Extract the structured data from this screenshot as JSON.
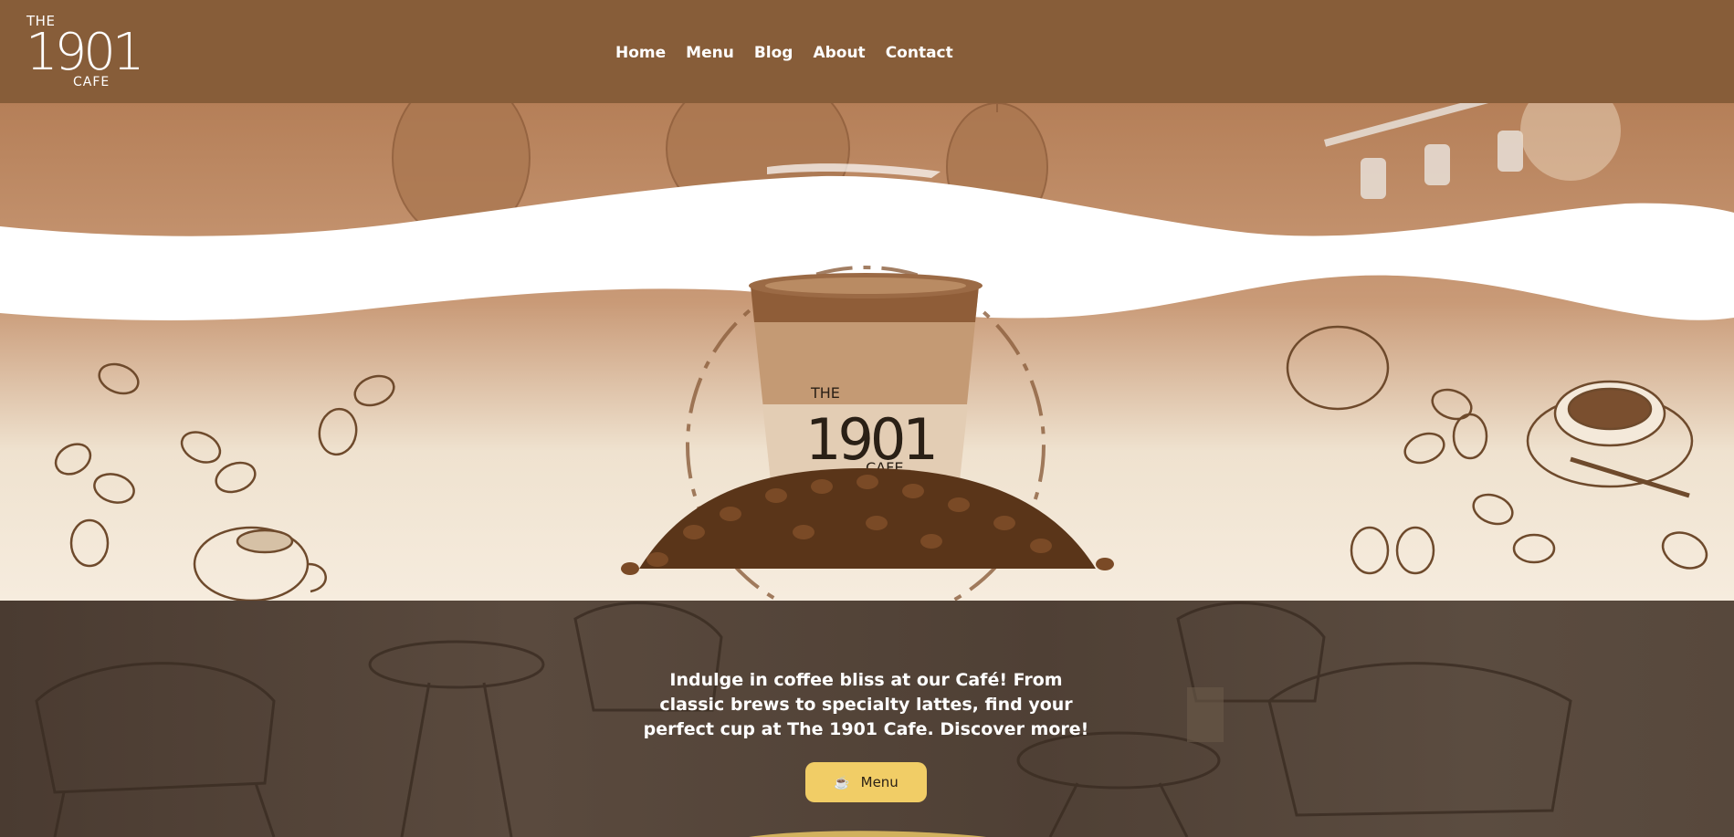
{
  "brand": {
    "line1": "THE",
    "number": "1901",
    "line3": "CAFE"
  },
  "nav": [
    {
      "label": "Home"
    },
    {
      "label": "Menu"
    },
    {
      "label": "Blog"
    },
    {
      "label": "About"
    },
    {
      "label": "Contact"
    }
  ],
  "product_logo": {
    "line1": "THE",
    "number": "1901",
    "line3": "CAFE"
  },
  "hero": {
    "tagline": "Indulge in coffee bliss at our Café! From classic brews to specialty lattes, find your perfect cup at The 1901 Cafe. Discover more!",
    "button_label": "Menu",
    "button_icon": "coffee-cup-icon"
  },
  "colors": {
    "header": "#875d39",
    "button": "#f1cd66",
    "text": "#ffffff"
  }
}
